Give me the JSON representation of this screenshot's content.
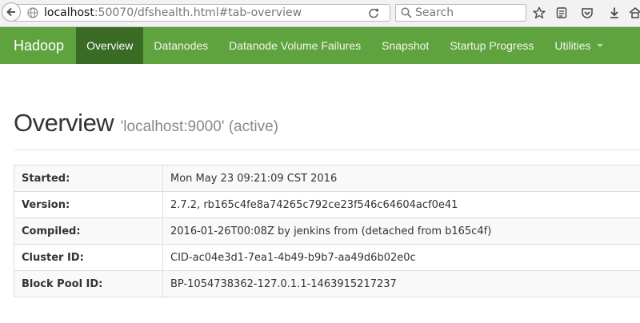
{
  "browser": {
    "url_host": "localhost",
    "url_rest": ":50070/dfshealth.html#tab-overview",
    "search_placeholder": "Search"
  },
  "navbar": {
    "brand": "Hadoop",
    "items": [
      {
        "label": "Overview",
        "active": true
      },
      {
        "label": "Datanodes"
      },
      {
        "label": "Datanode Volume Failures"
      },
      {
        "label": "Snapshot"
      },
      {
        "label": "Startup Progress"
      },
      {
        "label": "Utilities",
        "dropdown": true
      }
    ],
    "colors": {
      "bar": "#5fa33e",
      "active": "#3a6b24"
    }
  },
  "page": {
    "title": "Overview",
    "subtitle": "'localhost:9000' (active)"
  },
  "info_table": {
    "rows": [
      {
        "key": "Started:",
        "value": "Mon May 23 09:21:09 CST 2016"
      },
      {
        "key": "Version:",
        "value": "2.7.2, rb165c4fe8a74265c792ce23f546c64604acf0e41"
      },
      {
        "key": "Compiled:",
        "value": "2016-01-26T00:08Z by jenkins from (detached from b165c4f)"
      },
      {
        "key": "Cluster ID:",
        "value": "CID-ac04e3d1-7ea1-4b49-b9b7-aa49d6b02e0c"
      },
      {
        "key": "Block Pool ID:",
        "value": "BP-1054738362-127.0.1.1-1463915217237"
      }
    ]
  },
  "icons": {
    "back": "back-arrow-icon",
    "site": "globe-icon",
    "reload": "reload-icon",
    "search": "search-icon",
    "bookmark": "bookmark-star-icon",
    "reading_list": "reading-list-icon",
    "pocket": "pocket-icon",
    "download": "download-icon",
    "home": "home-icon"
  }
}
